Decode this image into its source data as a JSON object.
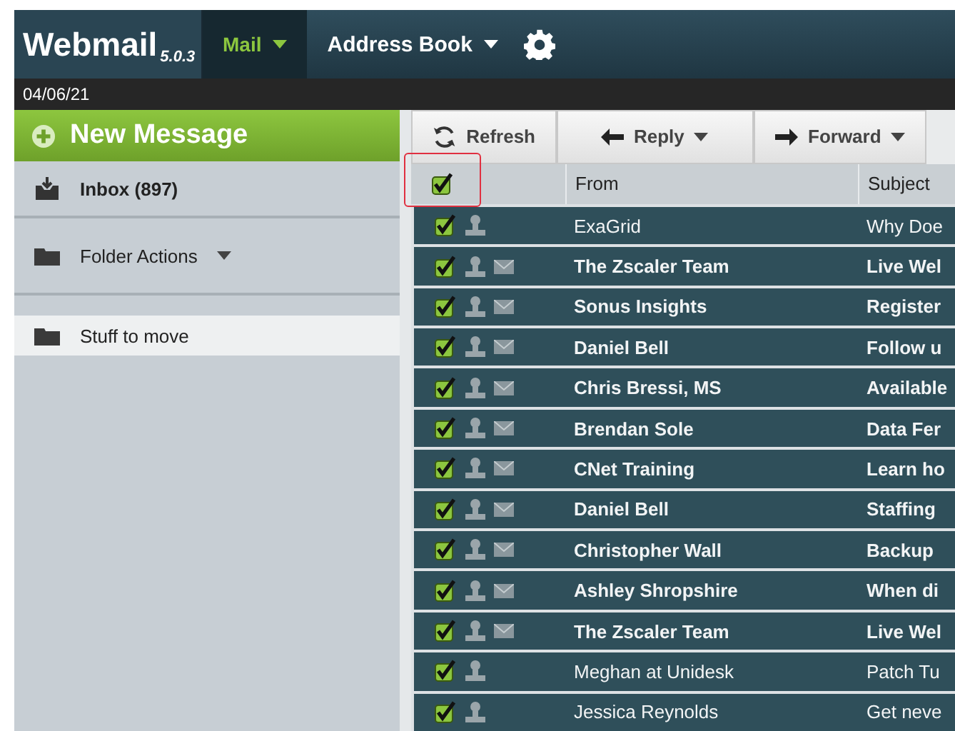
{
  "brand": {
    "name": "Webmail",
    "version": "5.0.3"
  },
  "nav": [
    {
      "label": "Mail",
      "selected": true,
      "dropdown": true
    },
    {
      "label": "Address Book",
      "selected": false,
      "dropdown": true
    }
  ],
  "date": "04/06/21",
  "new_message": "New Message",
  "sidebar": {
    "items": [
      {
        "label": "Inbox (897)",
        "kind": "inbox",
        "selected": false,
        "dropdown": false
      },
      {
        "label": "Folder Actions",
        "kind": "folder",
        "selected": false,
        "dropdown": true
      },
      {
        "label": "Stuff to move",
        "kind": "folder",
        "selected": true,
        "dropdown": false
      }
    ]
  },
  "toolbar": [
    {
      "label": "Refresh",
      "kind": "refresh",
      "dropdown": false
    },
    {
      "label": "Reply",
      "kind": "reply",
      "dropdown": true
    },
    {
      "label": "Forward",
      "kind": "forward",
      "dropdown": true
    }
  ],
  "table": {
    "select_all": {
      "checked": true,
      "highlighted": true
    },
    "columns": [
      "From",
      "Subject"
    ],
    "rows": [
      {
        "from": "ExaGrid",
        "subject": "Why Doe",
        "checked": true,
        "unread": false,
        "envelope": false
      },
      {
        "from": "The Zscaler Team",
        "subject": "Live Wel",
        "checked": true,
        "unread": true,
        "envelope": true
      },
      {
        "from": "Sonus Insights",
        "subject": "Register",
        "checked": true,
        "unread": true,
        "envelope": true
      },
      {
        "from": "Daniel Bell",
        "subject": "Follow u",
        "checked": true,
        "unread": true,
        "envelope": true
      },
      {
        "from": "Chris Bressi, MS",
        "subject": "Available",
        "checked": true,
        "unread": true,
        "envelope": true
      },
      {
        "from": "Brendan Sole",
        "subject": "Data Fer",
        "checked": true,
        "unread": true,
        "envelope": true
      },
      {
        "from": "CNet Training",
        "subject": "Learn ho",
        "checked": true,
        "unread": true,
        "envelope": true
      },
      {
        "from": "Daniel Bell",
        "subject": "Staffing",
        "checked": true,
        "unread": true,
        "envelope": true
      },
      {
        "from": "Christopher Wall",
        "subject": "Backup",
        "checked": true,
        "unread": true,
        "envelope": true
      },
      {
        "from": "Ashley Shropshire",
        "subject": "When di",
        "checked": true,
        "unread": true,
        "envelope": true
      },
      {
        "from": "The Zscaler Team",
        "subject": "Live Wel",
        "checked": true,
        "unread": true,
        "envelope": true
      },
      {
        "from": "Meghan at Unidesk",
        "subject": "Patch Tu",
        "checked": true,
        "unread": false,
        "envelope": false
      },
      {
        "from": "Jessica Reynolds",
        "subject": "Get neve",
        "checked": true,
        "unread": false,
        "envelope": false
      }
    ]
  }
}
